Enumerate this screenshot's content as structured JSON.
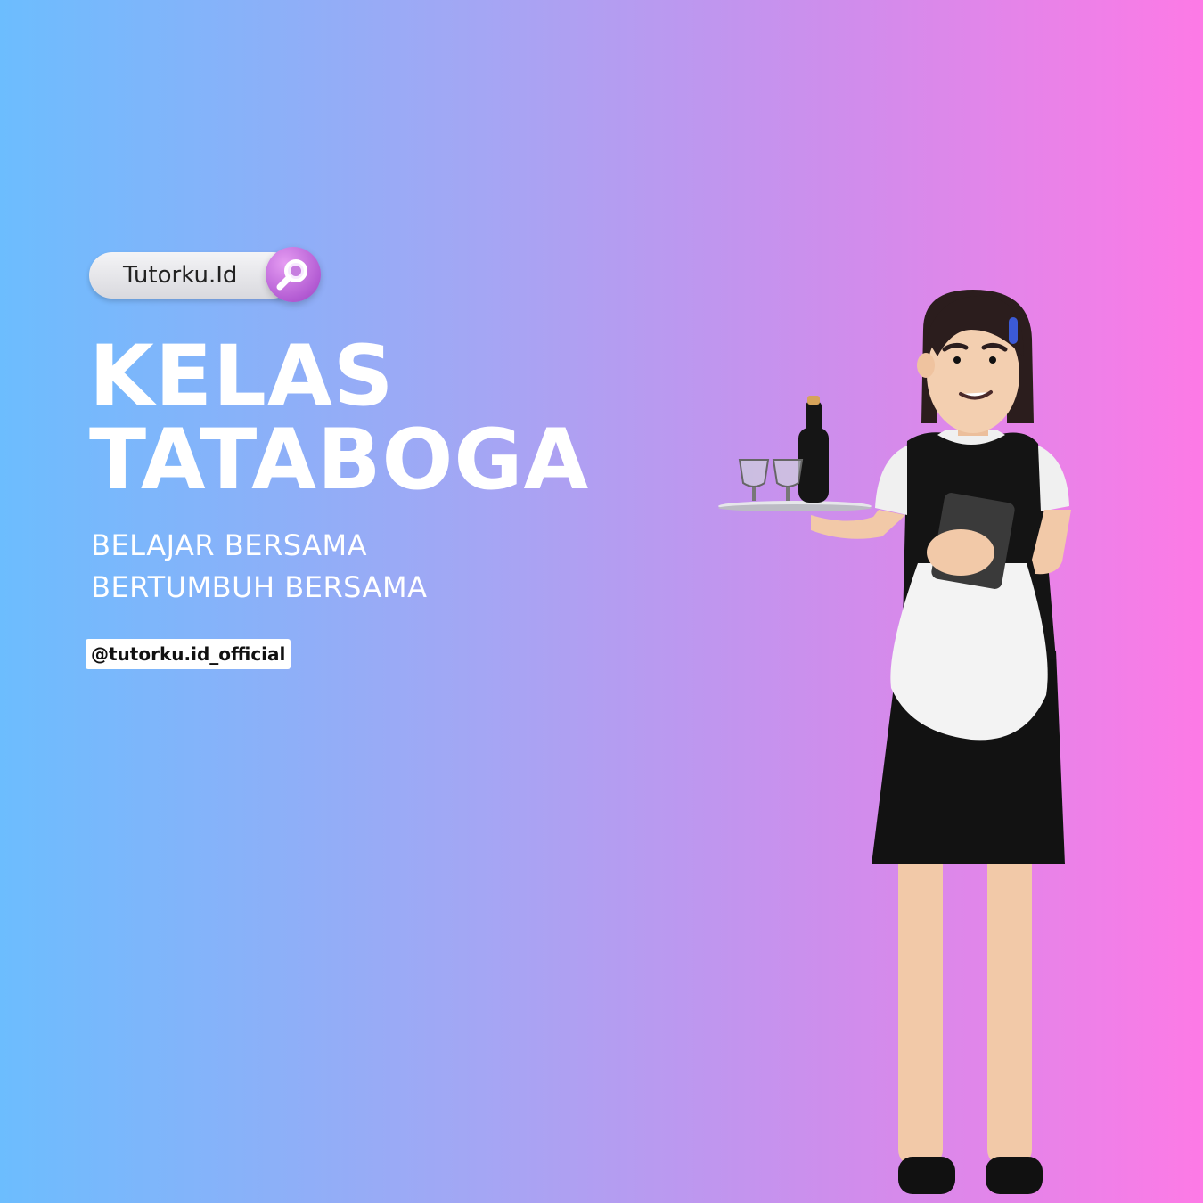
{
  "brand": {
    "search_text": "Tutorku.Id",
    "handle": "@tutorku.id_official"
  },
  "headline": {
    "line1": "KELAS",
    "line2": "TATABOGA"
  },
  "tagline": {
    "line1": "BELAJAR BERSAMA",
    "line2": "BERTUMBUH BERSAMA"
  },
  "icons": {
    "search": "magnifier-icon",
    "illustration": "waitress-illustration"
  },
  "colors": {
    "gradient_left": "#6cbdfe",
    "gradient_right": "#fd7ae6",
    "search_button": "#b35bd3",
    "text": "#ffffff"
  }
}
